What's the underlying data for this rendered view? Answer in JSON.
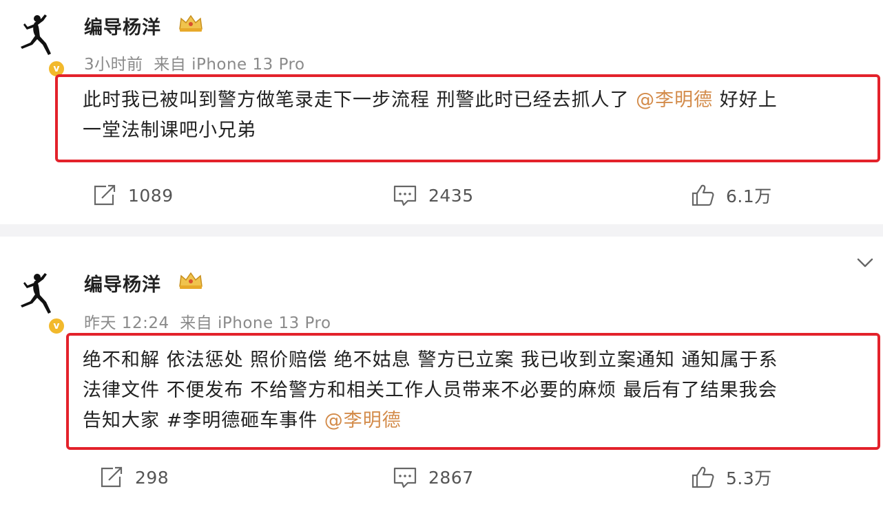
{
  "posts": [
    {
      "author": "编导杨洋",
      "meta": "3小时前  来自 iPhone 13 Pro",
      "text_before_mention": "此时我已被叫到警方做笔录走下一步流程 刑警此时已经去抓人了 ",
      "mention": "@李明德",
      "text_after_mention_line1": " 好好上",
      "text_line2": "一堂法制课吧小兄弟",
      "reposts": "1089",
      "comments": "2435",
      "likes": "6.1万"
    },
    {
      "author": "编导杨洋",
      "meta": "昨天 12:24  来自 iPhone 13 Pro",
      "line1": "绝不和解 依法惩处 照价赔偿 绝不姑息 警方已立案 我已收到立案通知 通知属于系",
      "line2": "法律文件 不便发布 不给警方和相关工作人员带来不必要的麻烦 最后有了结果我会",
      "line3_text": "告知大家 #李明德砸车事件 ",
      "line3_mention": "@李明德",
      "reposts": "298",
      "comments": "2867",
      "likes": "5.3万"
    }
  ],
  "icons": {
    "avatar": "jumpman-logo-icon",
    "verified": "verified-badge-icon",
    "crown": "crown-icon",
    "repost": "repost-icon",
    "comment": "comment-icon",
    "like": "like-icon",
    "more": "chevron-down-icon"
  },
  "colors": {
    "highlight_box": "#e3222b",
    "mention": "#d38b4a",
    "verified": "#f2b92c",
    "meta_text": "#8a8a8a"
  }
}
